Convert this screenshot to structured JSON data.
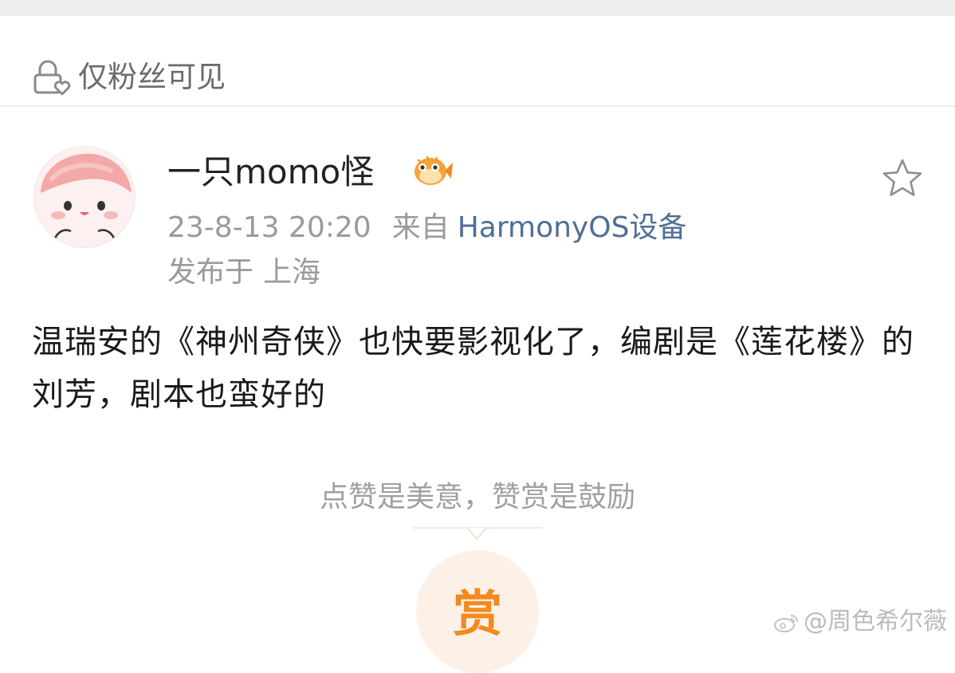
{
  "visibility": {
    "label": "仅粉丝可见",
    "icon": "lock-heart-icon"
  },
  "post": {
    "author": {
      "name": "一只momo怪",
      "avatar_icon": "pink-character-avatar",
      "badge_icon": "pufferfish-badge-icon"
    },
    "time": "23-8-13 20:20",
    "from_label": "来自",
    "device": "HarmonyOS设备",
    "location_label": "发布于",
    "location": "上海",
    "favorite_icon": "star-outline-icon",
    "text": "温瑞安的《神州奇侠》也快要影视化了，编剧是《莲花楼》的刘芳，剧本也蛮好的"
  },
  "reward": {
    "caption": "点赞是美意，赞赏是鼓励",
    "button_label": "赏"
  },
  "watermark": {
    "text": "@周色希尔薇",
    "icon": "weibo-logo-icon"
  },
  "colors": {
    "link": "#4e6f96",
    "reward_orange": "#f28a1e",
    "meta_gray": "#9a9a9a"
  }
}
